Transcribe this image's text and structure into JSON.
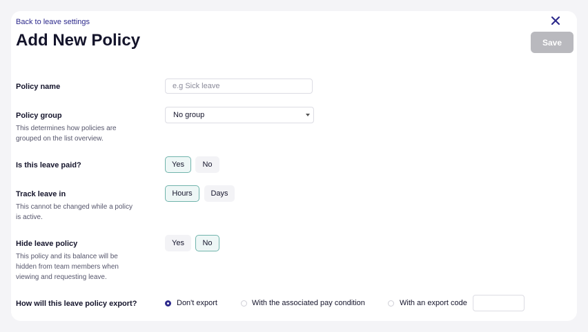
{
  "header": {
    "back_link": "Back to leave settings",
    "title": "Add New Policy",
    "save_label": "Save"
  },
  "policy_name": {
    "label": "Policy name",
    "placeholder": "e.g Sick leave"
  },
  "policy_group": {
    "label": "Policy group",
    "description": "This determines how policies are grouped on the list overview.",
    "selected": "No group"
  },
  "paid": {
    "label": "Is this leave paid?",
    "options": [
      "Yes",
      "No"
    ],
    "selected": "Yes"
  },
  "track": {
    "label": "Track leave in",
    "description": "This cannot be changed while a policy is active.",
    "options": [
      "Hours",
      "Days"
    ],
    "selected": "Hours"
  },
  "hide": {
    "label": "Hide leave policy",
    "description": "This policy and its balance will be hidden from team members when viewing and requesting leave.",
    "options": [
      "Yes",
      "No"
    ],
    "selected": "No"
  },
  "export": {
    "label": "How will this leave policy export?",
    "options": [
      "Don't export",
      "With the associated pay condition",
      "With an export code"
    ],
    "selected": "Don't export"
  },
  "colors": {
    "accent": "#2d2a8c",
    "active_border": "#6fb3ab",
    "save_disabled": "#b9b9be"
  }
}
